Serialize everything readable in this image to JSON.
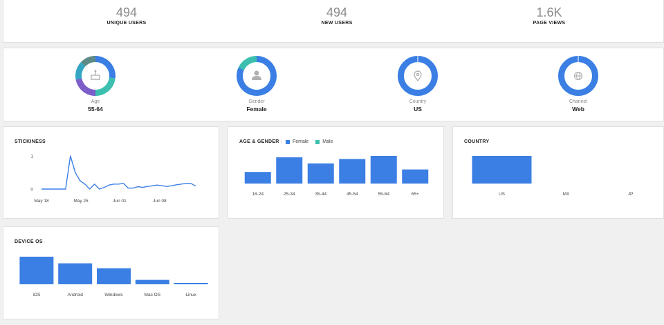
{
  "summary": {
    "unique_users": {
      "value": "494",
      "label": "UNIQUE USERS"
    },
    "new_users": {
      "value": "494",
      "label": "NEW USERS"
    },
    "page_views": {
      "value": "1.6K",
      "label": "PAGE VIEWS"
    }
  },
  "breakdowns": [
    {
      "label": "Age",
      "value": "55-64",
      "icon": "cake-icon",
      "segments": [
        {
          "fraction": 0.27,
          "color": "#3b7fe4"
        },
        {
          "fraction": 0.23,
          "color": "#3dbfb0"
        },
        {
          "fraction": 0.22,
          "color": "#7d5ec9"
        },
        {
          "fraction": 0.15,
          "color": "#34a6c4"
        },
        {
          "fraction": 0.13,
          "color": "#5e8a86"
        }
      ]
    },
    {
      "label": "Gender",
      "value": "Female",
      "icon": "person-icon",
      "segments": [
        {
          "fraction": 0.82,
          "color": "#3b7fe4"
        },
        {
          "fraction": 0.18,
          "color": "#3dbfb0"
        }
      ]
    },
    {
      "label": "Country",
      "value": "US",
      "icon": "location-pin-icon",
      "segments": [
        {
          "fraction": 1.0,
          "color": "#3b7fe4"
        }
      ]
    },
    {
      "label": "Channel",
      "value": "Web",
      "icon": "globe-icon",
      "segments": [
        {
          "fraction": 1.0,
          "color": "#3b7fe4"
        }
      ]
    }
  ],
  "stickiness": {
    "title": "STICKINESS",
    "chart_data": {
      "type": "line",
      "title": "STICKINESS",
      "x_tick_labels": [
        "May 18",
        "May 25",
        "Jun 01",
        "Jun 08"
      ],
      "y_tick_labels": [
        "1",
        "0"
      ],
      "ylim": [
        0,
        1
      ],
      "series": [
        {
          "values": [
            0,
            0,
            0,
            0,
            0,
            0,
            1,
            0.5,
            0.25,
            0.15,
            0,
            0.15,
            0,
            0.05,
            0.12,
            0.15,
            0.15,
            0.17,
            0.03,
            0.03,
            0.07,
            0.05,
            0.08,
            0.1,
            0.12,
            0.1,
            0.08,
            0.1,
            0.13,
            0.15,
            0.17,
            0.17,
            0.09
          ]
        }
      ],
      "color": "#3b7fe4"
    }
  },
  "age_gender": {
    "title": "AGE & GENDER",
    "legend": [
      {
        "name": "Female",
        "color": "#3b7fe4"
      },
      {
        "name": "Male",
        "color": "#3dbfb0"
      }
    ],
    "chart_data": {
      "type": "bar",
      "title": "AGE & GENDER",
      "categories": [
        "18-24",
        "25-34",
        "35-44",
        "45-54",
        "55-64",
        "65+"
      ],
      "series": [
        {
          "name": "Female",
          "values": [
            0.42,
            0.95,
            0.73,
            0.89,
            1.0,
            0.51
          ]
        },
        {
          "name": "Male",
          "values": [
            0,
            0,
            0,
            0,
            0,
            0
          ]
        }
      ]
    }
  },
  "country": {
    "title": "COUNTRY",
    "chart_data": {
      "type": "bar",
      "title": "COUNTRY",
      "categories": [
        "US",
        "MX",
        "JP"
      ],
      "values": [
        1.0,
        0,
        0
      ]
    }
  },
  "device_os": {
    "title": "DEVICE OS",
    "chart_data": {
      "type": "bar",
      "title": "DEVICE OS",
      "categories": [
        "iOS",
        "Android",
        "Windows",
        "Mac OS",
        "Linux"
      ],
      "values": [
        1.0,
        0.76,
        0.58,
        0.16,
        0.05
      ]
    }
  },
  "colors": {
    "accent": "#3b7fe4",
    "secondary": "#3dbfb0"
  }
}
